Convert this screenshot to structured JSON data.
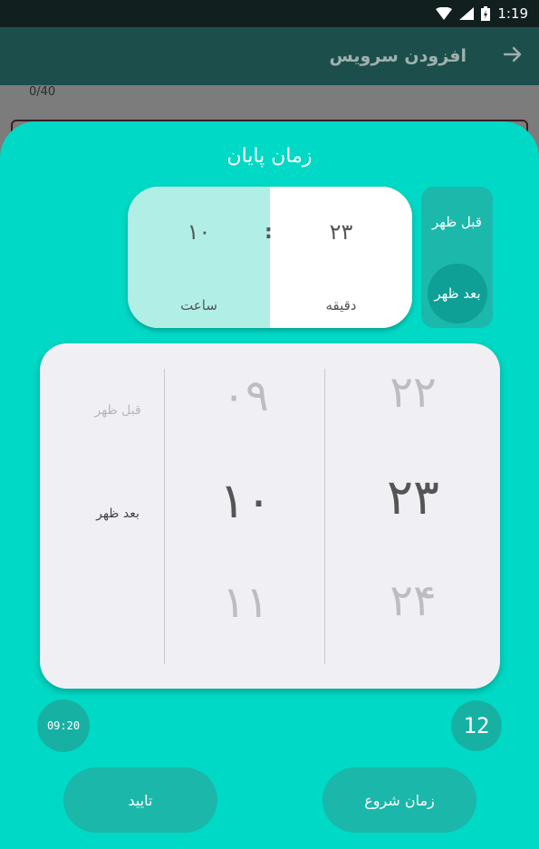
{
  "status_bar": {
    "time": "1:19"
  },
  "app_bar": {
    "title": "افزودن سرویس",
    "back_icon": "arrow-right-icon"
  },
  "background_form": {
    "counter": "0/40"
  },
  "sheet": {
    "title": "زمان پایان",
    "selected_time": {
      "hour_value": "۱۰",
      "hour_label": "ساعت",
      "separator": ":",
      "minute_value": "۲۳",
      "minute_label": "دقیقه"
    },
    "ampm": {
      "am_label": "قبل ظهر",
      "pm_label": "بعد ظهر",
      "selected": "pm"
    },
    "picker": {
      "ampm": [
        "قبل ظهر",
        "بعد ظهر"
      ],
      "hours": [
        "۰۹",
        "۱۰",
        "۱۱"
      ],
      "minutes": [
        "۲۲",
        "۲۳",
        "۲۴"
      ]
    },
    "clock_mode_button": "09:20",
    "format_button": "12",
    "confirm_button": "تایید",
    "start_time_button": "زمان شروع"
  },
  "colors": {
    "sheet_bg": "#00d9c5",
    "accent_dark": "#17b1a4",
    "hour_highlight": "#b1eee6",
    "app_bar": "#1c4f4b"
  }
}
